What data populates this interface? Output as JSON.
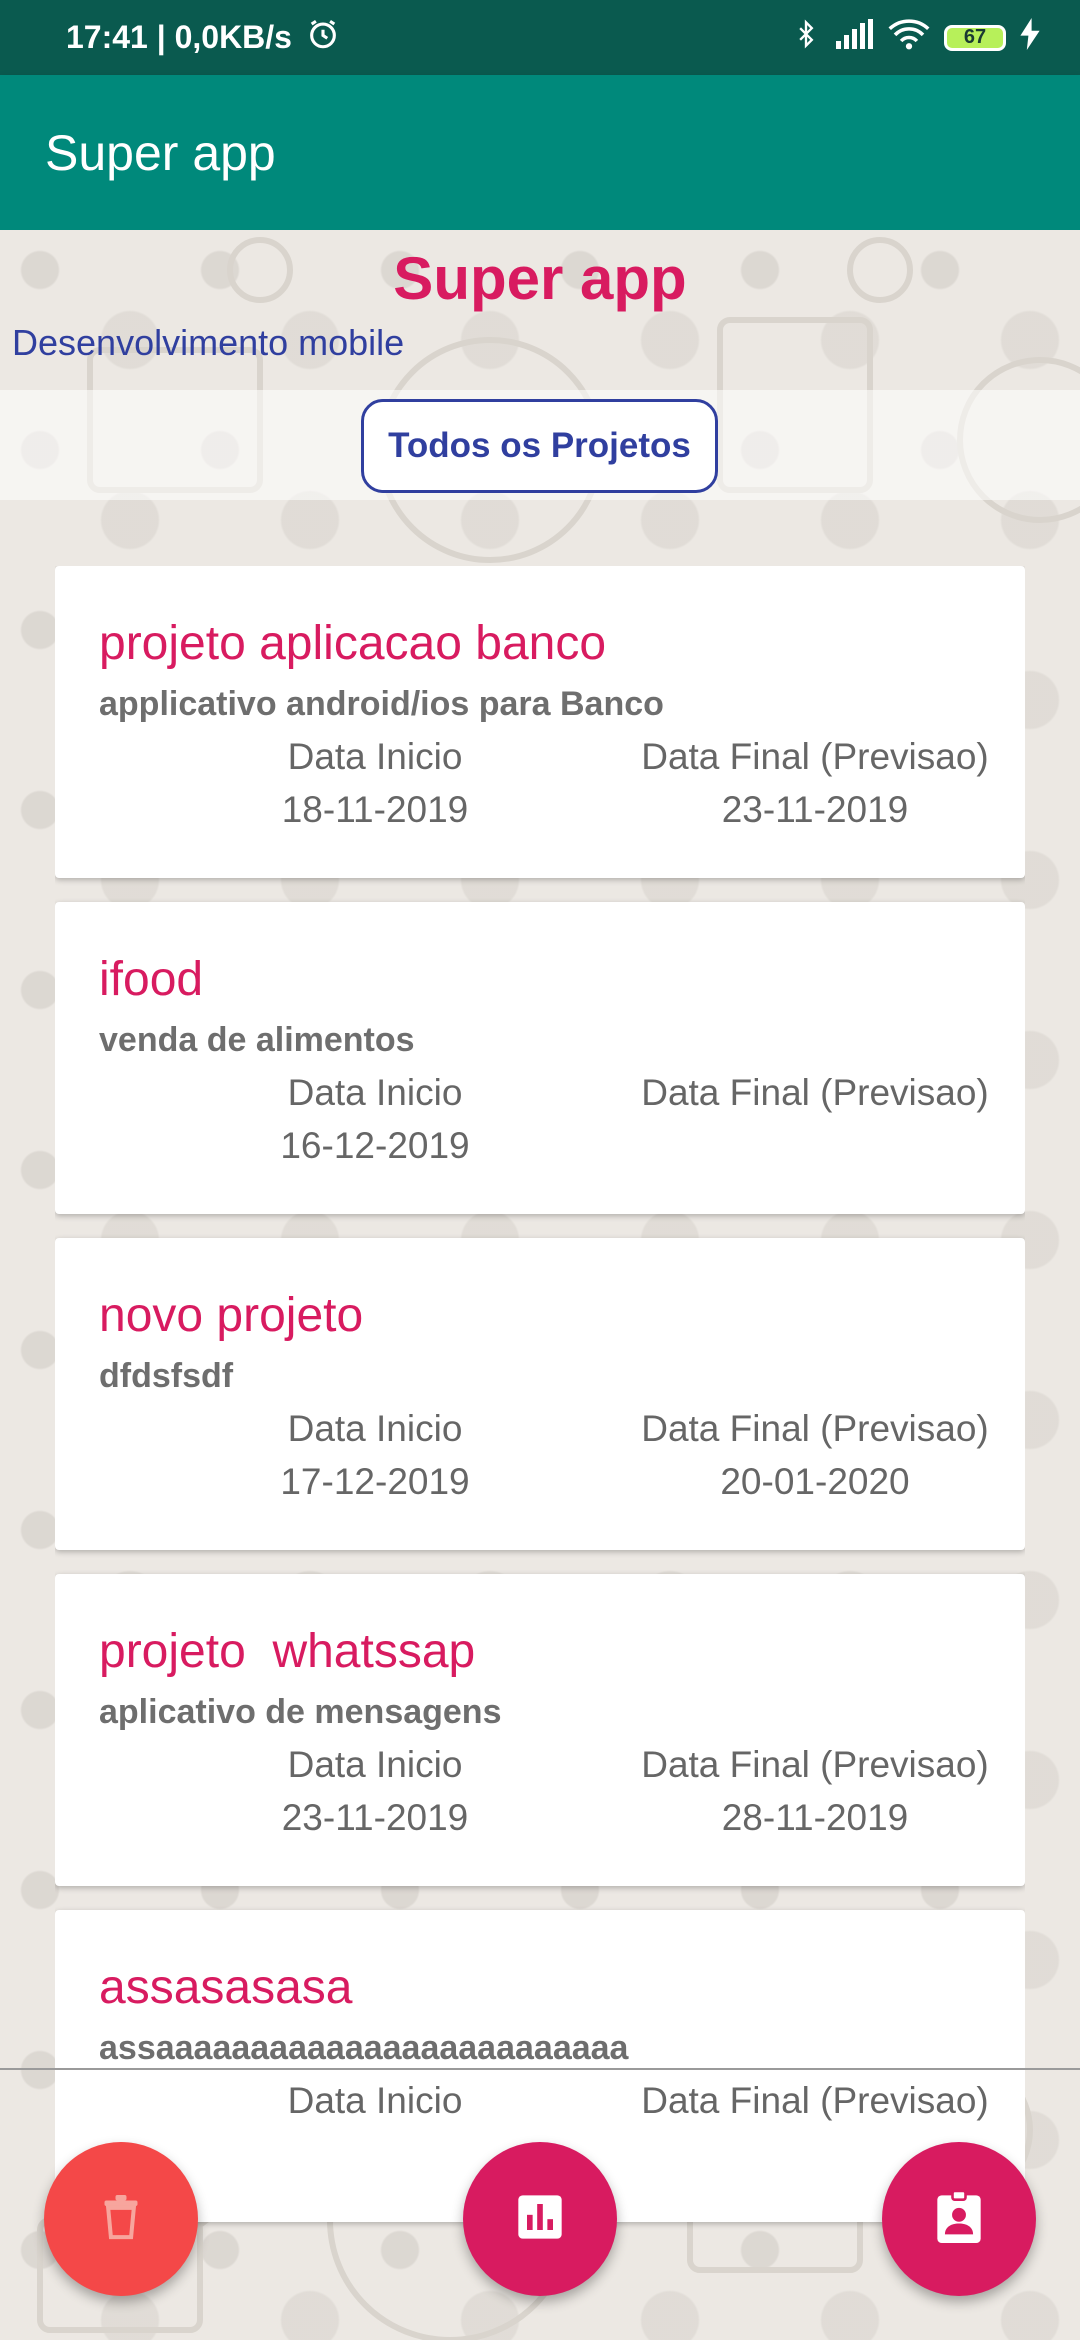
{
  "status_bar": {
    "time_speed": "17:41 | 0,0KB/s",
    "battery": "67"
  },
  "app_bar": {
    "title": "Super app"
  },
  "header": {
    "title": "Super app",
    "subtitle": "Desenvolvimento mobile",
    "filter_button": "Todos os Projetos"
  },
  "labels": {
    "start": "Data Inicio",
    "end": "Data Final (Previsao)"
  },
  "projects": [
    {
      "name": "projeto aplicacao banco",
      "description": "applicativo android/ios para Banco",
      "start": "18-11-2019",
      "end": "23-11-2019"
    },
    {
      "name": "ifood",
      "description": "venda de alimentos",
      "start": "16-12-2019",
      "end": ""
    },
    {
      "name": "novo projeto",
      "description": "dfdsfsdf",
      "start": "17-12-2019",
      "end": "20-01-2020"
    },
    {
      "name": "projeto  whatssap",
      "description": "aplicativo de mensagens",
      "start": "23-11-2019",
      "end": "28-11-2019"
    },
    {
      "name": "assasasasa",
      "description": "assaaaaaaaaaaaaaaaaaaaaaaaaa",
      "start": "",
      "end": ""
    }
  ],
  "fabs": [
    {
      "icon": "trash-icon",
      "color": "#f44848"
    },
    {
      "icon": "bar-chart-icon",
      "color": "#d81b60"
    },
    {
      "icon": "contact-badge-icon",
      "color": "#d81b60"
    }
  ],
  "colors": {
    "status_bar": "#0a5a4f",
    "app_bar": "#00897b",
    "accent_pink": "#d81b60",
    "accent_indigo": "#303f9f"
  }
}
